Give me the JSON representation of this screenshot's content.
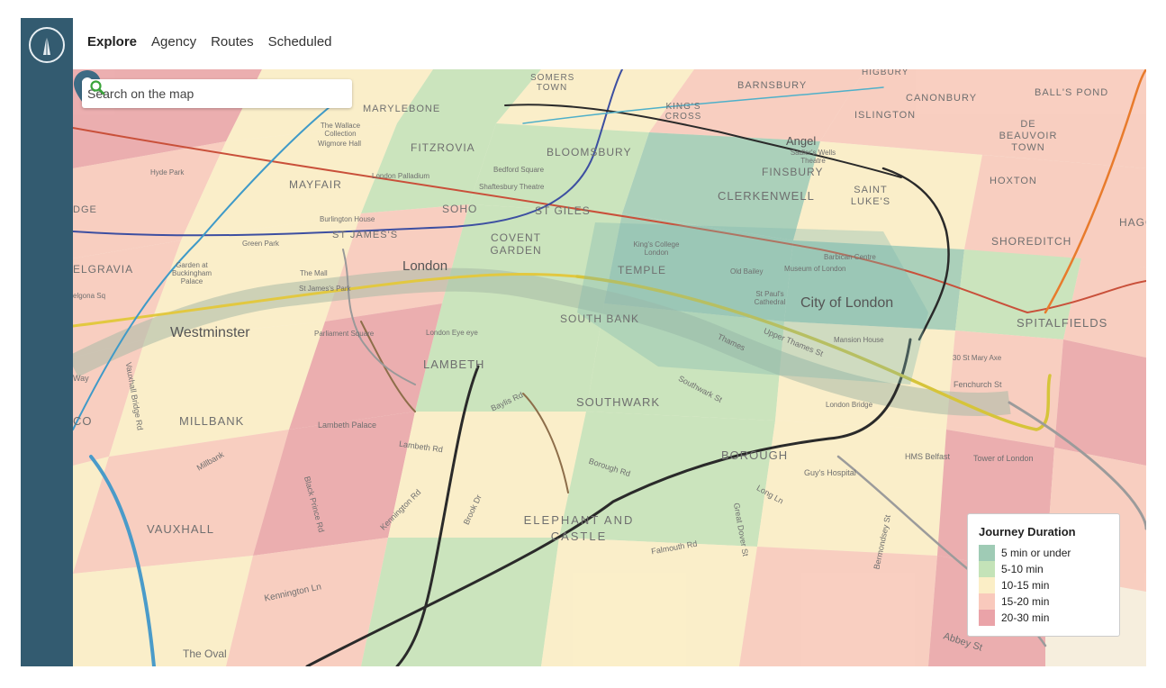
{
  "nav": {
    "items": [
      {
        "label": "Explore",
        "active": true
      },
      {
        "label": "Agency",
        "active": false
      },
      {
        "label": "Routes",
        "active": false
      },
      {
        "label": "Scheduled",
        "active": false
      }
    ]
  },
  "search": {
    "placeholder": "Search on the map",
    "icon": "search-icon",
    "icon_color": "#3aa43a"
  },
  "legend": {
    "title": "Journey Duration",
    "items": [
      {
        "label": "5 min or under",
        "color": "#9fcbb5"
      },
      {
        "label": "5-10 min",
        "color": "#c4e3b8"
      },
      {
        "label": "10-15 min",
        "color": "#fbeec6"
      },
      {
        "label": "15-20 min",
        "color": "#f9c9bc"
      },
      {
        "label": "20-30 min",
        "color": "#eaa3a8"
      }
    ]
  },
  "map": {
    "labels": {
      "marylebone": "MARYLEBONE",
      "fitzrovia": "FITZROVIA",
      "bloomsbury": "BLOOMSBURY",
      "barnsbury": "BARNSBURY",
      "islington": "ISLINGTON",
      "canonbury": "CANONBURY",
      "balls_pond": "BALL'S POND",
      "de_beauvoir": "DE BEAUVOIR TOWN",
      "hoxton": "HOXTON",
      "haggerston": "HAGGE",
      "shoreditch": "SHOREDITCH",
      "spitalfields": "SPITALFIELDS",
      "finsbury": "FINSBURY",
      "clerkenwell": "CLERKENWELL",
      "st_lukes": "SAINT LUKE'S",
      "angel": "Angel",
      "sadlers_wells": "Sadler's Wells Theatre",
      "mayfair": "MAYFAIR",
      "soho": "SOHO",
      "st_giles": "ST GILES",
      "covent_garden": "COVENT GARDEN",
      "st_james": "ST JAMES'S",
      "london": "London",
      "temple": "TEMPLE",
      "kings_college": "King's College London",
      "old_bailey": "Old Bailey",
      "museum_of_london": "Museum of London",
      "barbican": "Barbican Centre",
      "st_pauls": "St Paul's Cathedral",
      "city_of_london": "City of London",
      "mansion_house": "Mansion House",
      "st_mary_axe": "30 St Mary Axe",
      "fenchurch": "Fenchurch St",
      "upper_thames": "Upper Thames St",
      "thames": "Thames",
      "london_bridge": "London Bridge",
      "hms_belfast": "HMS Belfast",
      "tower_of_london": "Tower of London",
      "south_bank": "SOUTH BANK",
      "westminster": "Westminster",
      "parliament_square": "Parliament Square",
      "london_eye": "London Eye eye",
      "lambeth": "LAMBETH",
      "southwark": "SOUTHWARK",
      "southwark_st": "Southwark St",
      "baylis_rd": "Baylis Rd",
      "millbank": "MILLBANK",
      "millbank_rd": "Millbank",
      "lambeth_palace": "Lambeth Palace",
      "lambeth_rd": "Lambeth Rd",
      "borough": "BOROUGH",
      "borough_rd": "Borough Rd",
      "guys_hospital": "Guy's Hospital",
      "long_ln": "Long Ln",
      "elephant_castle": "ELEPHANT AND CASTLE",
      "falmouth_rd": "Falmouth Rd",
      "great_dover": "Great Dover St",
      "bermondsey": "Bermondsey St",
      "vauxhall": "VAUXHALL",
      "black_prince": "Black Prince Rd",
      "kennington_rd": "Kennington Rd",
      "brook_dr": "Brook Dr",
      "kennington_ln": "Kennington Ln",
      "the_oval": "The Oval",
      "abbey_st": "Abbey St",
      "belgravia": "ELGRAVIA",
      "garden_palace": "Garden at Buckingham Palace",
      "the_mall": "The Mall",
      "st_james_park": "St James's Park",
      "green_park": "Green Park",
      "hyde_park": "Hyde Park",
      "burlington": "Burlington House",
      "london_palladium": "London Palladium",
      "bedford_sq": "Bedford Square",
      "shaftesbury": "Shaftesbury Theatre",
      "wallace": "The Wallace Collection",
      "wigmore": "Wigmore Hall",
      "kings_cross": "KING'S CROSS",
      "somers_town": "SOMERS TOWN",
      "highbury": "HIGBURY",
      "vauxhall_bridge": "Vauxhall Bridge Rd",
      "edge": "DGE",
      "co": "CO",
      "way": "Way",
      "elgona": "elgona Sq"
    }
  }
}
